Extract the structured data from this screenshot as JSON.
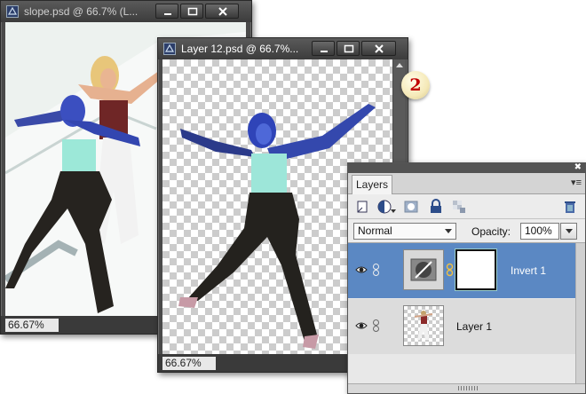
{
  "windows": {
    "back": {
      "title": "slope.psd @ 66.7% (L...",
      "zoom": "66.67%"
    },
    "front": {
      "title": "Layer 12.psd @ 66.7%...",
      "zoom": "66.67%"
    }
  },
  "callout": {
    "number": "2"
  },
  "layers_panel": {
    "tab": "Layers",
    "blend_mode": "Normal",
    "opacity_label": "Opacity:",
    "opacity_value": "100%",
    "layers": [
      {
        "name": "Invert 1",
        "selected": true
      },
      {
        "name": "Layer 1",
        "selected": false
      }
    ],
    "tools": [
      "new-layer-icon",
      "adjustment-layer-icon",
      "layer-mask-icon",
      "lock-icon",
      "lock-transparency-icon",
      "trash-icon"
    ]
  },
  "colors": {
    "selected_row": "#5b88c3",
    "callout_text": "#c00000"
  }
}
